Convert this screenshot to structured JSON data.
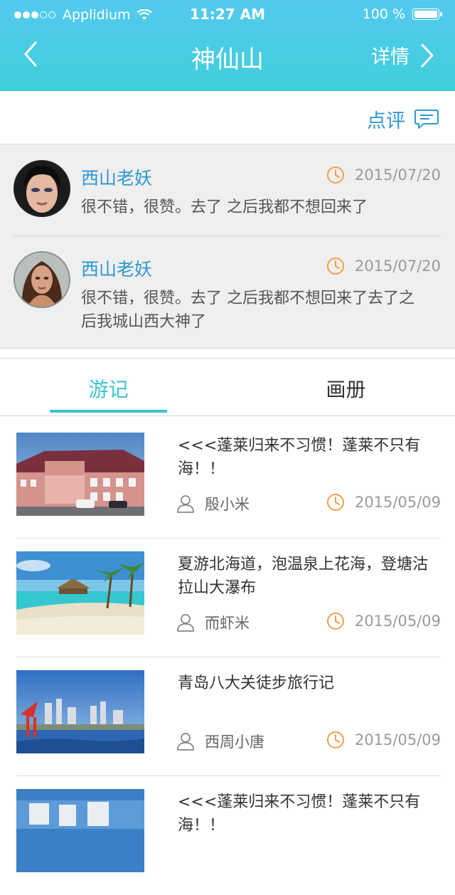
{
  "status_bar": {
    "carrier": "Applidium",
    "time": "11:27 AM",
    "battery": "100 %"
  },
  "nav": {
    "title": "神仙山",
    "detail_label": "详情"
  },
  "comment_bar": {
    "label": "点评"
  },
  "reviews": [
    {
      "name": "西山老妖",
      "date": "2015/07/20",
      "text": "很不错，很赞。去了 之后我都不想回来了"
    },
    {
      "name": "西山老妖",
      "date": "2015/07/20",
      "text": "很不错，很赞。去了 之后我都不想回来了去了之后我城山西大神了"
    }
  ],
  "tabs": [
    {
      "label": "游记",
      "active": true
    },
    {
      "label": "画册",
      "active": false
    }
  ],
  "journals": [
    {
      "title": "<<<蓬莱归来不习惯！蓬莱不只有海！！",
      "author": "殷小米",
      "date": "2015/05/09"
    },
    {
      "title": "夏游北海道，泡温泉上花海，登塘沽拉山大瀑布",
      "author": "而虾米",
      "date": "2015/05/09"
    },
    {
      "title": "青岛八大关徒步旅行记",
      "author": "西周小唐",
      "date": "2015/05/09"
    },
    {
      "title": "<<<蓬莱归来不习惯！蓬莱不只有海！！",
      "author": "",
      "date": ""
    }
  ],
  "colors": {
    "header_gradient_top": "#55c9ef",
    "header_gradient_bottom": "#3fcfd9",
    "accent_blue": "#2e98d0",
    "accent_teal": "#3bc3d1",
    "clock_orange": "#f0a04a"
  }
}
